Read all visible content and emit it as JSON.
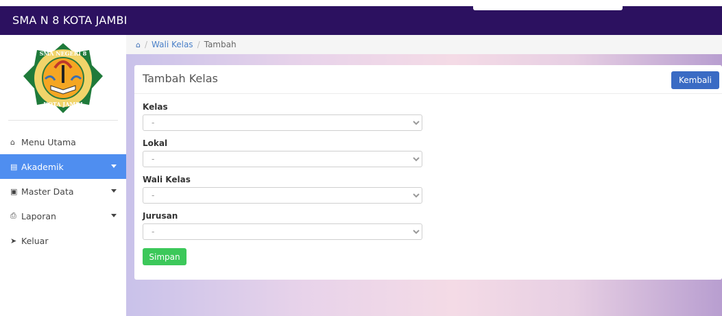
{
  "app": {
    "title": "SMA N 8 KOTA JAMBI"
  },
  "sidebar": {
    "logo_top_text": "SMA NEGERI 8",
    "logo_bottom_text": "KOTA JAMBI",
    "items": [
      {
        "label": "Menu Utama",
        "icon": "home-icon",
        "active": false,
        "has_caret": false
      },
      {
        "label": "Akademik",
        "icon": "bank-icon",
        "active": true,
        "has_caret": true
      },
      {
        "label": "Master Data",
        "icon": "database-icon",
        "active": false,
        "has_caret": true
      },
      {
        "label": "Laporan",
        "icon": "printer-icon",
        "active": false,
        "has_caret": true
      },
      {
        "label": "Keluar",
        "icon": "sign-out-icon",
        "active": false,
        "has_caret": false
      }
    ]
  },
  "breadcrumb": {
    "link": "Wali Kelas",
    "current": "Tambah"
  },
  "card": {
    "title": "Tambah Kelas",
    "back_label": "Kembali"
  },
  "form": {
    "fields": [
      {
        "label": "Kelas",
        "value": "-"
      },
      {
        "label": "Lokal",
        "value": "-"
      },
      {
        "label": "Wali Kelas",
        "value": "-"
      },
      {
        "label": "Jurusan",
        "value": "-"
      }
    ],
    "submit_label": "Simpan"
  },
  "colors": {
    "topbar": "#2c1160",
    "sidebar_active": "#4f8ef0",
    "back_button": "#3a6bc4",
    "save_button": "#3cc85a"
  }
}
